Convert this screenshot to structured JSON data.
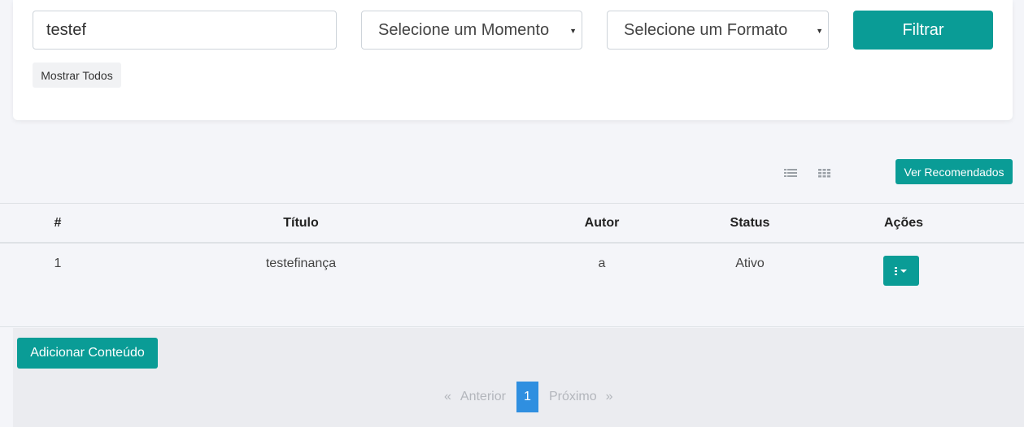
{
  "filters": {
    "search_value": "testef",
    "momento_label": "Selecione um Momento",
    "formato_label": "Selecione um Formato",
    "filtrar_label": "Filtrar",
    "mostrar_todos_label": "Mostrar Todos"
  },
  "toolbar": {
    "list_view_icon": "list-icon",
    "grid_view_icon": "grid-icon",
    "ver_recomendados_label": "Ver Recomendados"
  },
  "table": {
    "headers": [
      "#",
      "Título",
      "Autor",
      "Status",
      "Ações"
    ],
    "rows": [
      {
        "num": "1",
        "titulo": "testefinança",
        "autor": "a",
        "status": "Ativo"
      }
    ]
  },
  "footer": {
    "add_label": "Adicionar Conteúdo",
    "pagination": {
      "first_glyph": "«",
      "prev_label": "Anterior",
      "current_page": "1",
      "next_label": "Próximo",
      "last_glyph": "»"
    }
  },
  "colors": {
    "accent": "#0a9c96",
    "pagination_active": "#2f8fe0",
    "background": "#f4f5f9"
  }
}
